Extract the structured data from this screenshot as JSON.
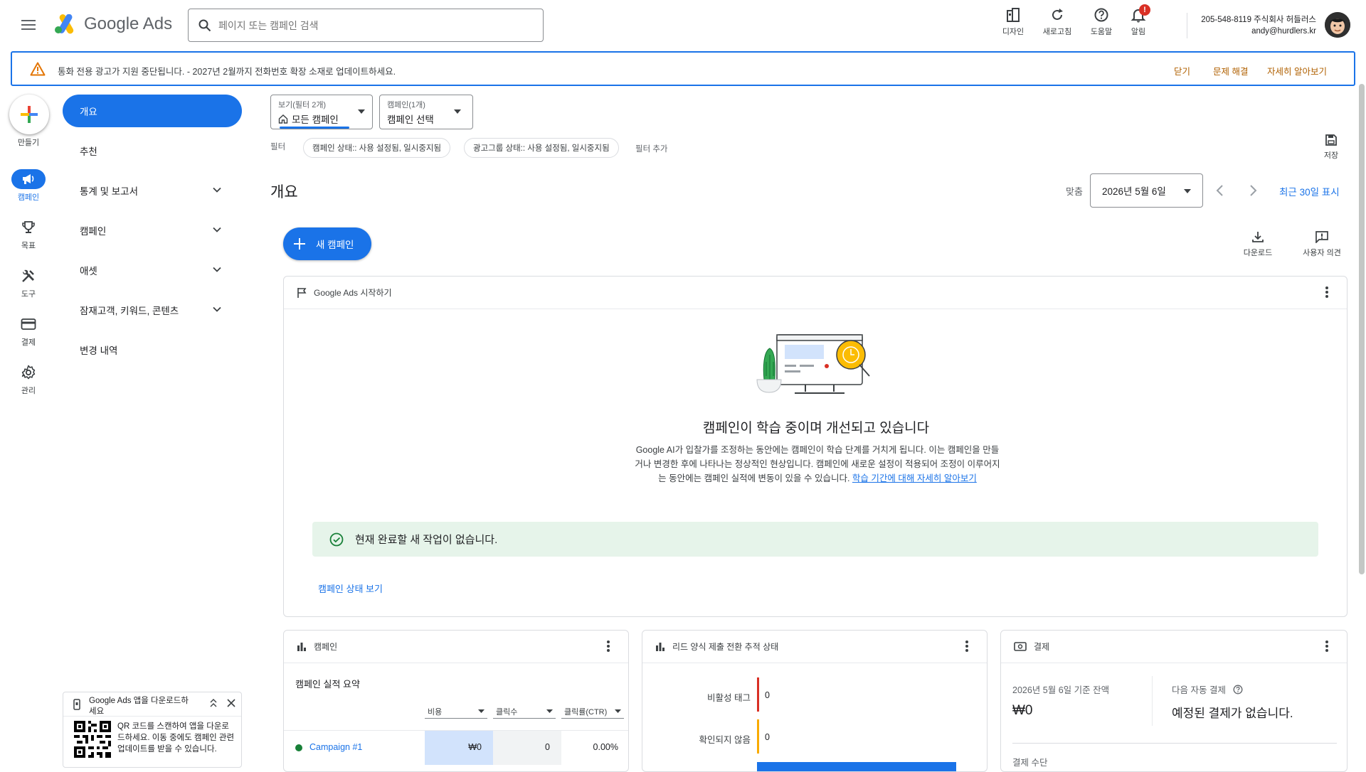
{
  "header": {
    "app_name": "Google Ads",
    "search_placeholder": "페이지 또는 캠페인 검색",
    "tools": [
      {
        "label": "디자인",
        "icon": "design-icon"
      },
      {
        "label": "새로고침",
        "icon": "refresh-icon"
      },
      {
        "label": "도움말",
        "icon": "help-icon"
      },
      {
        "label": "알림",
        "icon": "bell-icon",
        "badge": "!"
      }
    ],
    "account_line1": "205-548-8119 주식회사 허들러스",
    "account_line2": "andy@hurdlers.kr"
  },
  "banner": {
    "text": "통화 전용 광고가 지원 중단됩니다. - 2027년 2월까지 전화번호 확장 소재로 업데이트하세요.",
    "close": "닫기",
    "fix": "문제 해결",
    "learn": "자세히 알아보기"
  },
  "rail": {
    "create": "만들기",
    "items": [
      {
        "label": "캠페인",
        "icon": "megaphone-icon",
        "active": true
      },
      {
        "label": "목표",
        "icon": "trophy-icon"
      },
      {
        "label": "도구",
        "icon": "tools-icon"
      },
      {
        "label": "결제",
        "icon": "credit-card-icon"
      },
      {
        "label": "관리",
        "icon": "gear-icon"
      }
    ]
  },
  "nav": {
    "items": [
      {
        "label": "개요",
        "active": true
      },
      {
        "label": "추천"
      },
      {
        "label": "통계 및 보고서",
        "expandable": true
      },
      {
        "label": "캠페인",
        "expandable": true
      },
      {
        "label": "애셋",
        "expandable": true
      },
      {
        "label": "잠재고객, 키워드, 콘텐츠",
        "expandable": true
      },
      {
        "label": "변경 내역"
      }
    ]
  },
  "promo": {
    "title": "Google Ads 앱을 다운로드하세요",
    "body": "QR 코드를 스캔하여 앱을 다운로드하세요. 이동 중에도 캠페인 관련 업데이트를 받을 수 있습니다."
  },
  "filters": {
    "view_caption": "보기(필터 2개)",
    "view_value": "모든 캠페인",
    "campaign_caption": "캠페인(1개)",
    "campaign_value": "캠페인 선택",
    "filter_label": "필터",
    "chips": [
      "캠페인 상태:: 사용 설정됨, 일시중지됨",
      "광고그룹 상태:: 사용 설정됨, 일시중지됨"
    ],
    "add_filter": "필터 추가",
    "save": "저장"
  },
  "overview": {
    "title": "개요",
    "custom_label": "맞춤",
    "date": "2026년 5월 6일",
    "last30": "최근 30일 표시",
    "new_campaign": "새 캠페인",
    "download": "다운로드",
    "feedback": "사용자 의견"
  },
  "getting_started": {
    "header": "Google Ads 시작하기",
    "headline": "캠페인이 학습 중이며 개선되고 있습니다",
    "body": "Google AI가 입찰가를 조정하는 동안에는 캠페인이 학습 단계를 거치게 됩니다. 이는 캠페인을 만들거나 변경한 후에 나타나는 정상적인 현상입니다. 캠페인에 새로운 설정이 적용되어 조정이 이루어지는 동안에는 캠페인 실적에 변동이 있을 수 있습니다. ",
    "link": "학습 기간에 대해 자세히 알아보기",
    "done_message": "현재 완료할 새 작업이 없습니다.",
    "status_link": "캠페인 상태 보기"
  },
  "campaign_card": {
    "header": "캠페인",
    "summary_title": "캠페인 실적 요약",
    "columns": [
      "비용",
      "클릭수",
      "클릭률(CTR)"
    ],
    "rows": [
      {
        "name": "Campaign #1",
        "cost": "₩0",
        "clicks": "0",
        "ctr": "0.00%"
      }
    ]
  },
  "lead_card": {
    "header": "리드 양식 제출 전환 추적 상태",
    "rows": [
      {
        "label": "비활성 태그",
        "value": "0",
        "color": "#d93025"
      },
      {
        "label": "확인되지 않음",
        "value": "0",
        "color": "#f9ab00"
      }
    ]
  },
  "billing_card": {
    "header": "결제",
    "balance_label": "2026년 5월 6일 기준 잔액",
    "balance": "₩0",
    "next_label": "다음 자동 결제",
    "next_value": "예정된 결제가 없습니다.",
    "method_label": "결제 수단"
  },
  "colors": {
    "primary": "#1a73e8",
    "banner_warn": "#b06000",
    "success_bg": "#e6f4ea",
    "success": "#188038"
  }
}
